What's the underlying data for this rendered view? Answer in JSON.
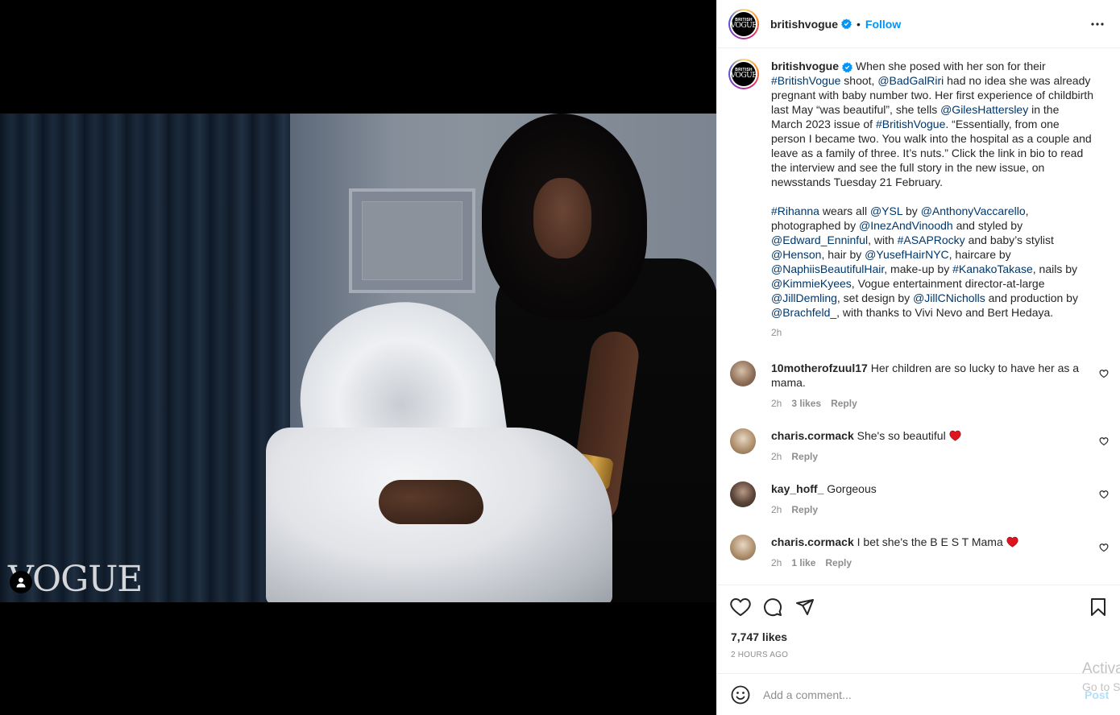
{
  "media": {
    "wordmark": "VOGUE"
  },
  "header": {
    "username": "britishvogue",
    "separator": "•",
    "follow_label": "Follow",
    "avatar_logo_line1": "BRITISH",
    "avatar_logo_line2": "VOGUE"
  },
  "caption": {
    "username": "britishvogue",
    "p1_a": " When she posed with her son for their ",
    "p1_tag1": "#BritishVogue",
    "p1_b": " shoot, ",
    "p1_mention1": "@BadGalRiri",
    "p1_c": " had no idea she was already pregnant with baby number two. Her first experience of childbirth last May “was beautiful”, she tells ",
    "p1_mention2": "@GilesHattersley",
    "p1_d": " in the March 2023 issue of ",
    "p1_tag2": "#BritishVogue",
    "p1_e": ". “Essentially, from one person I became two. You walk into the hospital as a couple and leave as a family of three. It’s nuts.” Click the link in bio to read the interview and see the full story in the new issue, on newsstands Tuesday 21 February.",
    "p2_tag": "#Rihanna",
    "p2_a": " wears all ",
    "p2_m1": "@YSL",
    "p2_b": " by ",
    "p2_m2": "@AnthonyVaccarello",
    "p2_c": ", photographed by ",
    "p2_m3": "@InezAndVinoodh",
    "p2_d": " and styled by ",
    "p2_m4": "@Edward_Enninful",
    "p2_e": ", with ",
    "p2_tag2": "#ASAPRocky",
    "p2_f": " and baby’s stylist ",
    "p2_m5": "@Henson",
    "p2_g": ", hair by ",
    "p2_m6": "@YusefHairNYC",
    "p2_h": ", haircare by ",
    "p2_m7": "@NaphiisBeautifulHair",
    "p2_i": ", make-up by ",
    "p2_tag3": "#KanakoTakase",
    "p2_j": ", nails by ",
    "p2_m8": "@KimmieKyees",
    "p2_k": ", Vogue entertainment director-at-large ",
    "p2_m9": "@JillDemling",
    "p2_l": ", set design by ",
    "p2_m10": "@JillCNicholls",
    "p2_m": " and production by ",
    "p2_m11": "@Brachfeld_",
    "p2_n": ", with thanks to Vivi Nevo and Bert Hedaya.",
    "time": "2h"
  },
  "comments": [
    {
      "username": "10motherofzuul17",
      "text": " Her children are so lucky to have her as a mama.",
      "time": "2h",
      "likes": "3 likes",
      "reply": "Reply"
    },
    {
      "username": "charis.cormack",
      "text": " She's so beautiful ",
      "time": "2h",
      "likes": "",
      "reply": "Reply"
    },
    {
      "username": "kay_hoff_",
      "text": " Gorgeous",
      "time": "2h",
      "likes": "",
      "reply": "Reply"
    },
    {
      "username": "charis.cormack",
      "text": " I bet she's the B E S T Mama ",
      "time": "2h",
      "likes": "1 like",
      "reply": "Reply"
    }
  ],
  "actions": {
    "likes": "7,747 likes",
    "time_ago": "2 HOURS AGO"
  },
  "composer": {
    "placeholder": "Add a comment...",
    "post_label": "Post"
  },
  "watermark": {
    "line1": "Activa",
    "line2": "Go to S"
  },
  "colors": {
    "link": "#00376b",
    "follow": "#0095f6",
    "heart_red": "#ed4956"
  }
}
